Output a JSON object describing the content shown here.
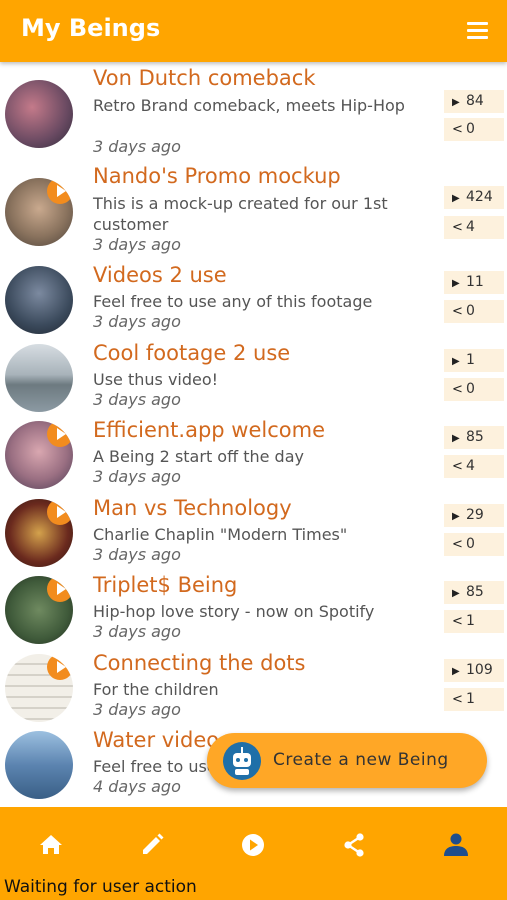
{
  "app": {
    "title": "My Beings"
  },
  "beings": [
    {
      "title": "Von Dutch comeback",
      "description": "Retro Brand comeback, meets Hip-Hop",
      "time": "3 days ago",
      "views": "84",
      "shares": "0",
      "has_video": false,
      "thumb_color": "#6a4a62"
    },
    {
      "title": "Nando's Promo mockup",
      "description": "This is a mock-up created for our 1st customer",
      "time": "3 days ago",
      "views": "424",
      "shares": "4",
      "has_video": true,
      "thumb_color": "#a9927a"
    },
    {
      "title": "Videos 2 use",
      "description": "Feel free to use any of this footage",
      "time": "3 days ago",
      "views": "11",
      "shares": "0",
      "has_video": false,
      "thumb_color": "#3b4a5c"
    },
    {
      "title": "Cool footage 2 use",
      "description": "Use thus video!",
      "time": "3 days ago",
      "views": "1",
      "shares": "0",
      "has_video": false,
      "thumb_color": "#8c9aa3"
    },
    {
      "title": "Efficient.app welcome",
      "description": "A Being 2 start off the day",
      "time": "3 days ago",
      "views": "85",
      "shares": "4",
      "has_video": true,
      "thumb_color": "#9a6f82"
    },
    {
      "title": "Man vs Technology",
      "description": "Charlie Chaplin \"Modern Times\"",
      "time": "3 days ago",
      "views": "29",
      "shares": "0",
      "has_video": true,
      "thumb_color": "#6b2a1e"
    },
    {
      "title": "Triplet$ Being",
      "description": "Hip-hop love story - now on Spotify",
      "time": "3 days ago",
      "views": "85",
      "shares": "1",
      "has_video": true,
      "thumb_color": "#3f5a3a"
    },
    {
      "title": "Connecting the dots",
      "description": "For the children",
      "time": "3 days ago",
      "views": "109",
      "shares": "1",
      "has_video": true,
      "thumb_color": "#f2efe8"
    },
    {
      "title": "Water video",
      "description": "Feel free to use",
      "time": "4 days ago",
      "views": "",
      "shares": "",
      "has_video": false,
      "thumb_color": "#5c84b0"
    }
  ],
  "fab": {
    "label": "Create a new Being"
  },
  "nav": {
    "items": [
      {
        "name": "home",
        "icon": "home-icon",
        "active": false
      },
      {
        "name": "edit",
        "icon": "pencil-icon",
        "active": false
      },
      {
        "name": "play",
        "icon": "play-circle-icon",
        "active": false
      },
      {
        "name": "share",
        "icon": "share-icon",
        "active": false
      },
      {
        "name": "profile",
        "icon": "person-icon",
        "active": true
      }
    ]
  },
  "status": {
    "text": "Waiting for user action"
  },
  "colors": {
    "primary": "#FFA500",
    "title": "#D2691E",
    "active_nav": "#1F4E8C",
    "stat_bg": "#FDF1DD"
  }
}
